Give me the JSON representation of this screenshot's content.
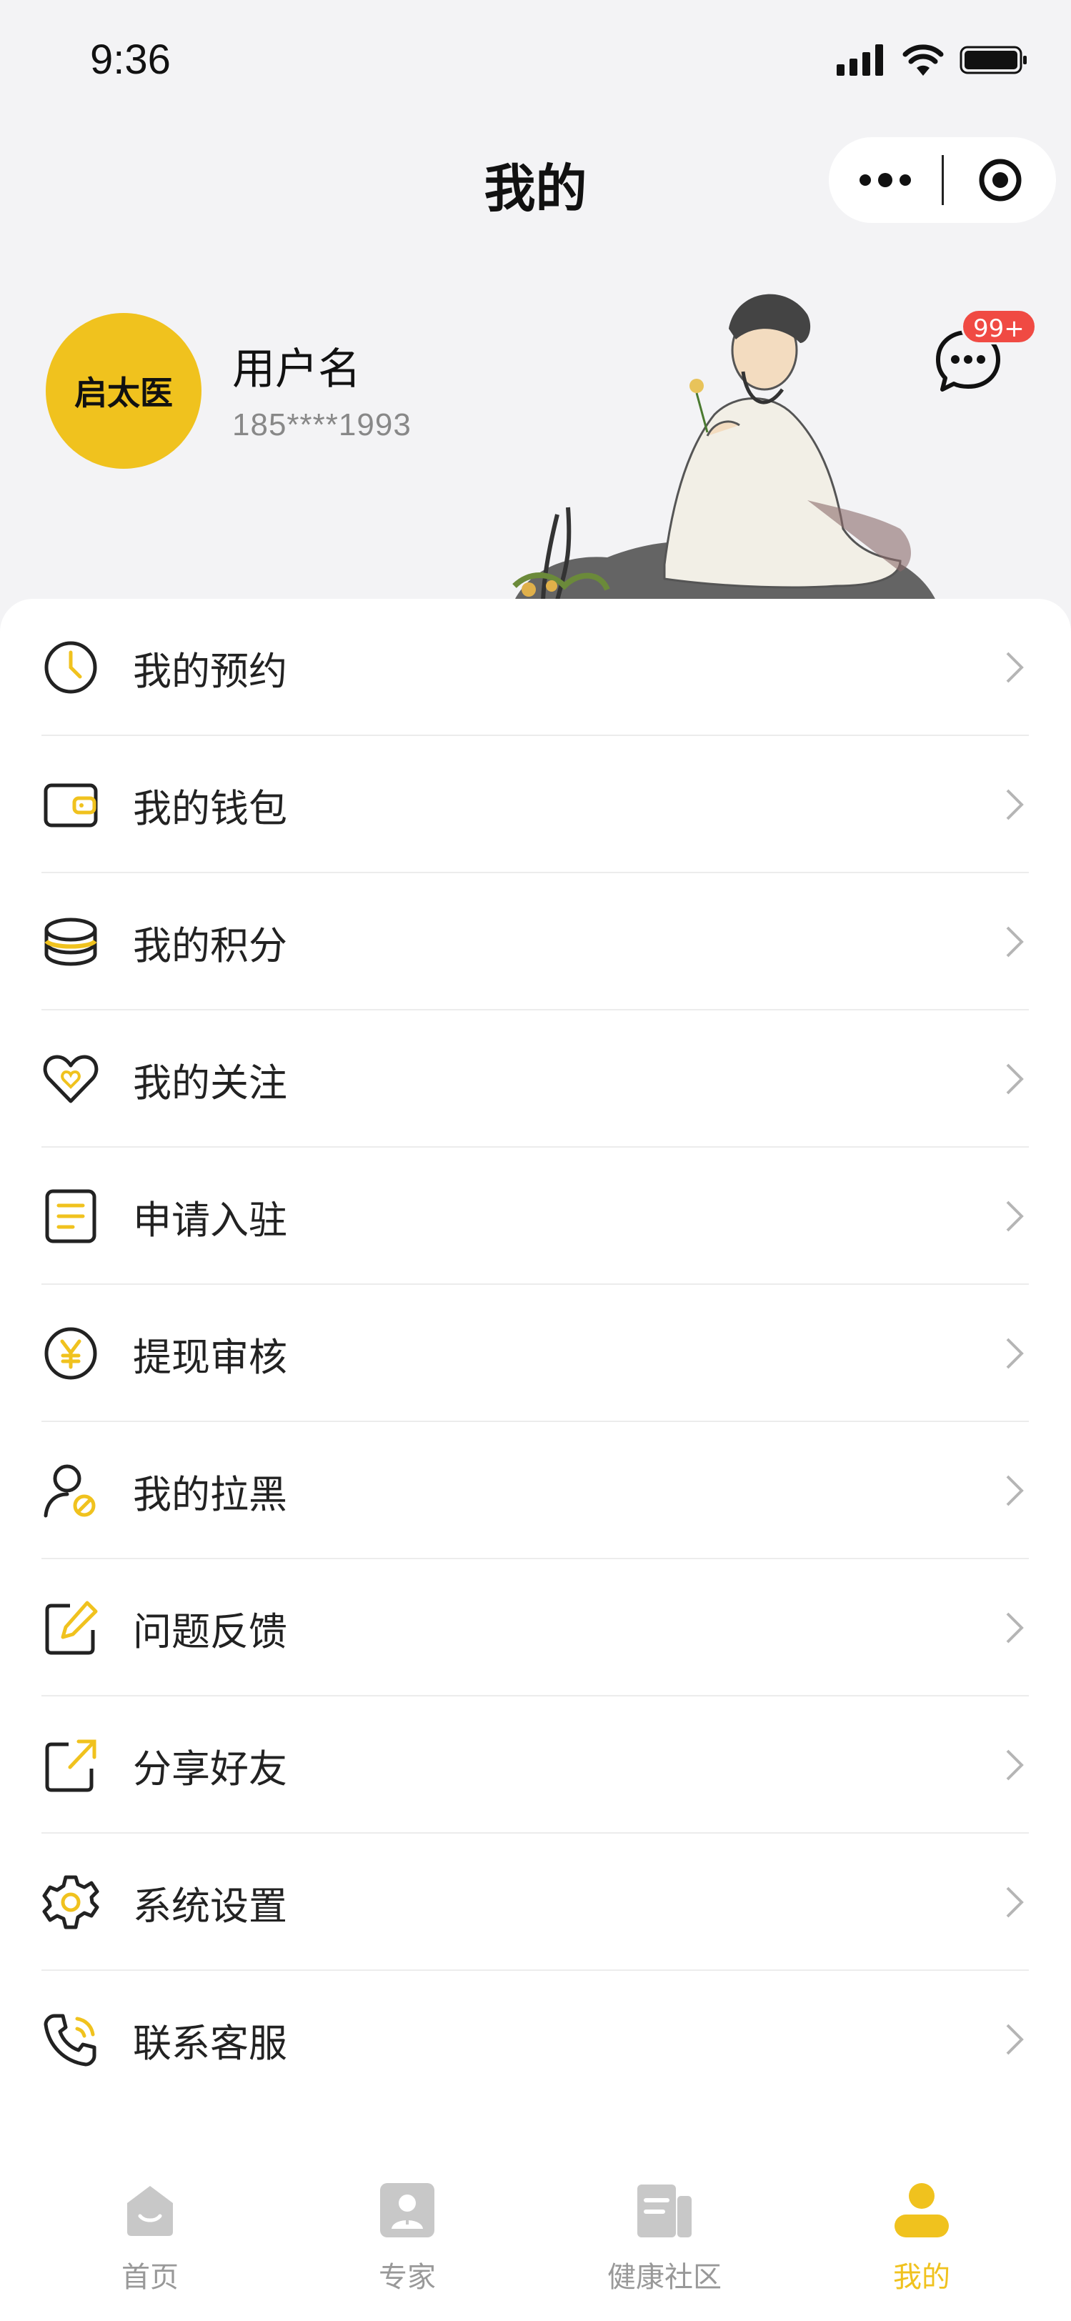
{
  "status_bar": {
    "time": "9:36"
  },
  "nav": {
    "title": "我的"
  },
  "profile": {
    "avatar_text": "启太医",
    "username": "用户名",
    "phone": "185****1993",
    "message_badge": "99+"
  },
  "menu": {
    "items": [
      {
        "label": "我的预约",
        "icon": "clock-icon"
      },
      {
        "label": "我的钱包",
        "icon": "wallet-icon"
      },
      {
        "label": "我的积分",
        "icon": "coins-icon"
      },
      {
        "label": "我的关注",
        "icon": "heart-icon"
      },
      {
        "label": "申请入驻",
        "icon": "document-icon"
      },
      {
        "label": "提现审核",
        "icon": "yen-icon"
      },
      {
        "label": "我的拉黑",
        "icon": "block-user-icon"
      },
      {
        "label": "问题反馈",
        "icon": "edit-icon"
      },
      {
        "label": "分享好友",
        "icon": "share-icon"
      },
      {
        "label": "系统设置",
        "icon": "gear-icon"
      },
      {
        "label": "联系客服",
        "icon": "phone-icon"
      }
    ]
  },
  "tabs": [
    {
      "label": "首页",
      "icon": "home-icon",
      "active": false
    },
    {
      "label": "专家",
      "icon": "expert-icon",
      "active": false
    },
    {
      "label": "健康社区",
      "icon": "community-icon",
      "active": false
    },
    {
      "label": "我的",
      "icon": "profile-icon",
      "active": true
    }
  ],
  "colors": {
    "accent": "#f0c21e",
    "badge": "#f04a43",
    "background": "#f3f3f5"
  }
}
